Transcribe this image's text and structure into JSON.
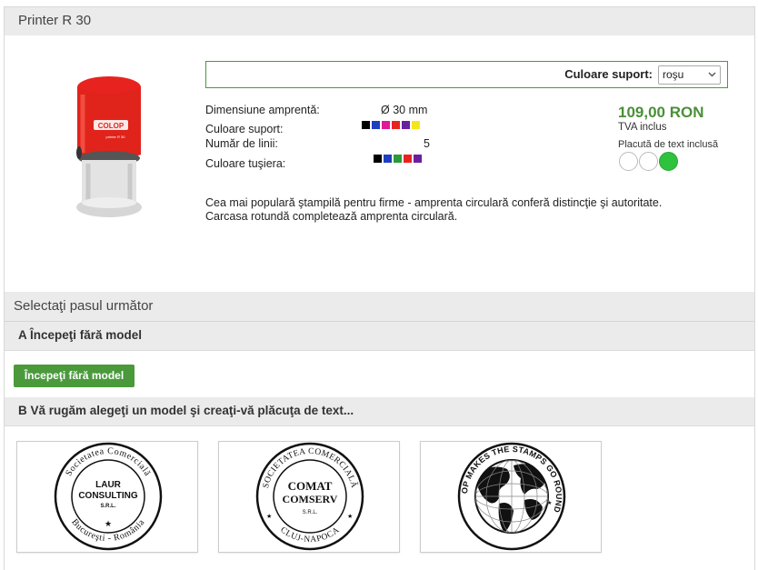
{
  "header": {
    "title": "Printer R 30"
  },
  "product": {
    "image_brand": "COLOP",
    "image_model": "printer R 30",
    "support_color": {
      "label": "Culoare suport:",
      "selected": "roşu"
    },
    "specs": [
      {
        "label": "Dimensiune amprentă:",
        "value": "Ø 30 mm"
      },
      {
        "label": "Culoare suport:",
        "value": ""
      },
      {
        "label": "Număr de linii:",
        "value": "5"
      },
      {
        "label": "Culoare tuşiera:",
        "value": ""
      }
    ],
    "support_swatches": [
      "#000000",
      "#1f3fbf",
      "#e0189a",
      "#e8231f",
      "#6a1f9e",
      "#f5e61c"
    ],
    "ink_swatches": [
      "#000000",
      "#1f3fbf",
      "#2a9a3a",
      "#e8231f",
      "#6a1f9e"
    ],
    "price": "109,00 RON",
    "tva": "TVA inclus",
    "plate_note": "Placută de text inclusă",
    "description_line1": "Cea mai populară ştampilă pentru firme - amprenta circulară conferă distincţie şi autoritate.",
    "description_line2": "Carcasa rotundă completează amprenta circulară."
  },
  "steps": {
    "title": "Selectaţi pasul următor",
    "section_a": "A Începeţi fără model",
    "button_a": "Începeţi fără model",
    "section_b": "B Vă rugăm alegeţi un model şi creaţi-vă plăcuţa de text..."
  },
  "templates": [
    {
      "ring_text": "Societatea Comercială",
      "bottom_text": "Bucureşti - România",
      "center1": "LAUR",
      "center2": "CONSULTING",
      "center3": "S.R.L."
    },
    {
      "ring_text": "SOCIETATEA COMERCIALĂ",
      "bottom_text": "CLUJ-NAPOCA",
      "center1": "COMAT",
      "center2": "COMSERV",
      "center3": "S.R.L."
    },
    {
      "ring_text": "COLOP MAKES THE STAMPS GO ROUND"
    }
  ]
}
